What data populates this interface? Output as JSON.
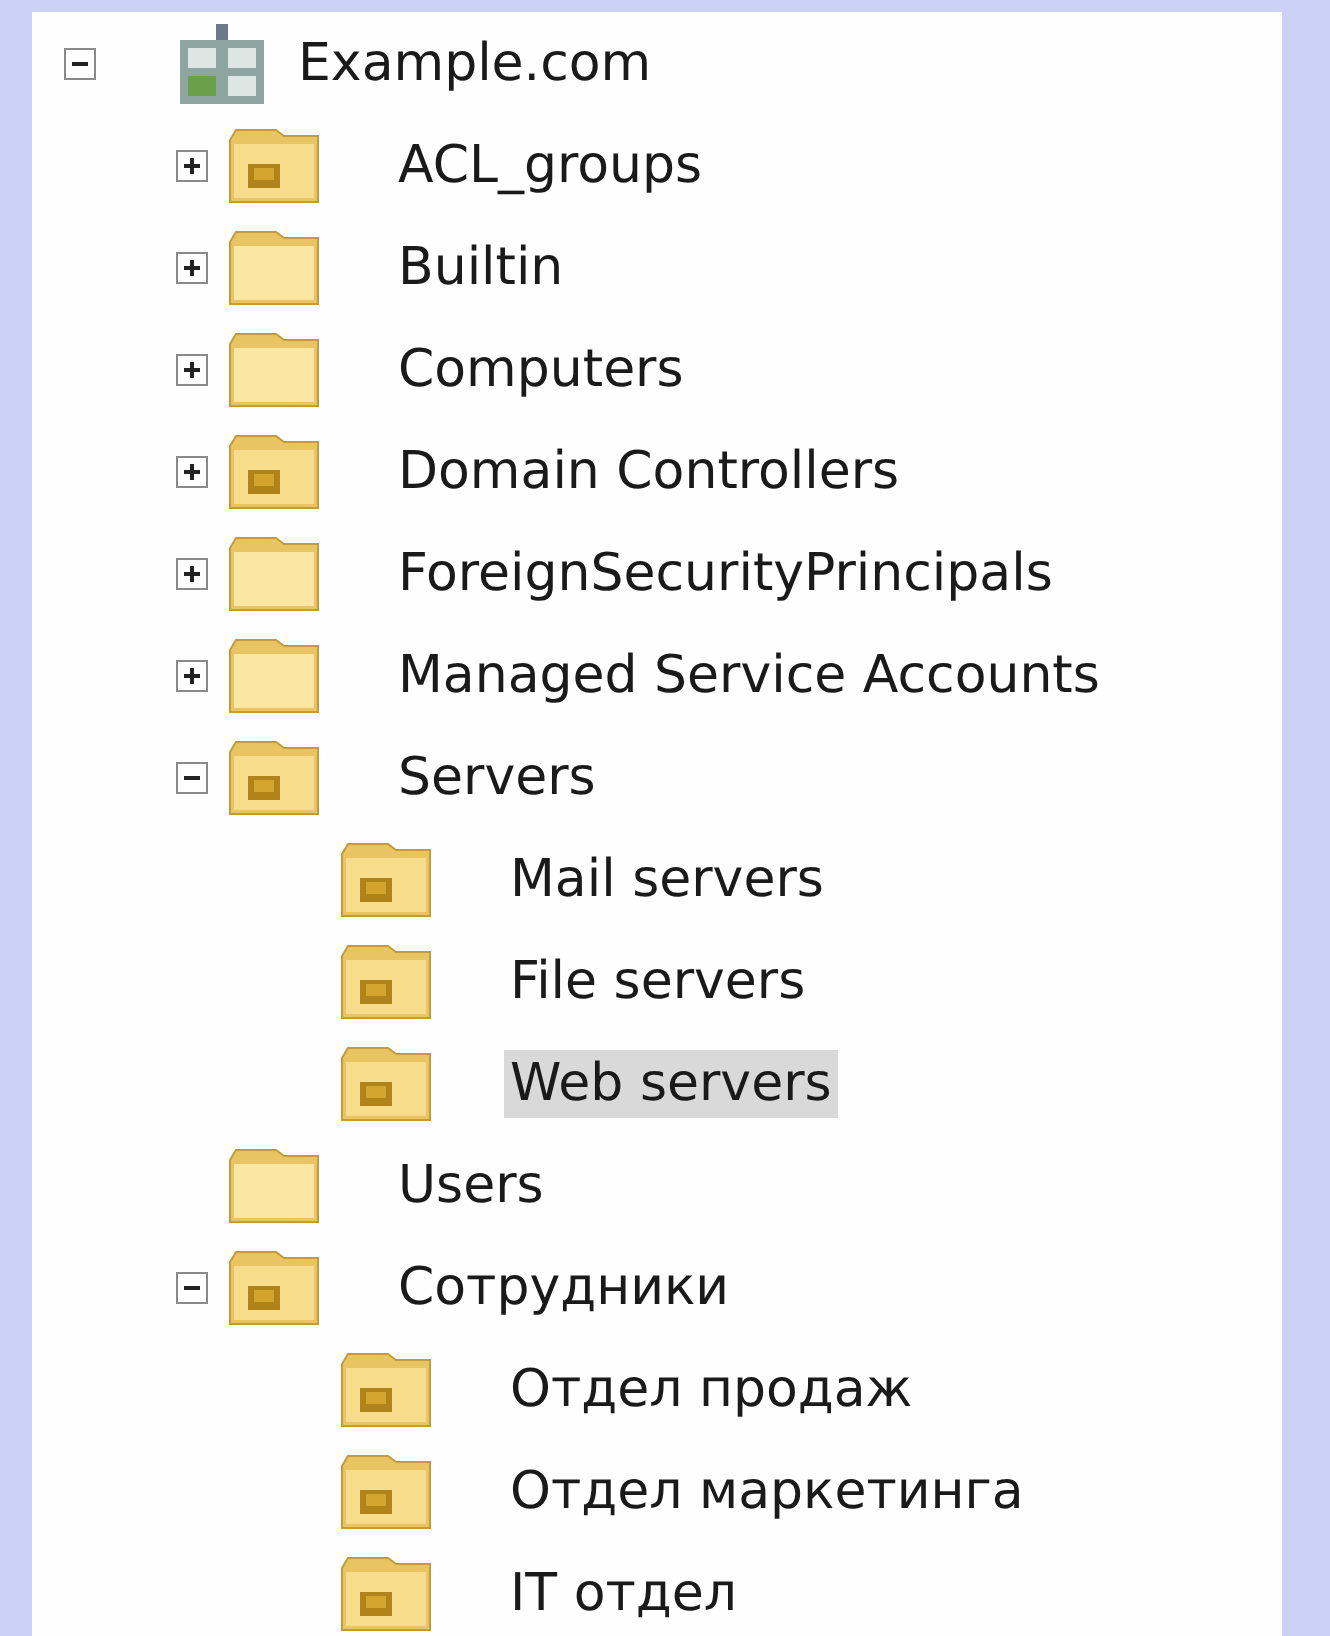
{
  "tree": [
    {
      "label": "Example.com",
      "kind": "domain",
      "expanded": true,
      "selected": false,
      "children": [
        {
          "label": "ACL_groups",
          "kind": "ou",
          "expanded": false,
          "selected": false
        },
        {
          "label": "Builtin",
          "kind": "container",
          "expanded": false,
          "selected": false
        },
        {
          "label": "Computers",
          "kind": "container",
          "expanded": false,
          "selected": false
        },
        {
          "label": "Domain Controllers",
          "kind": "ou",
          "expanded": false,
          "selected": false
        },
        {
          "label": "ForeignSecurityPrincipals",
          "kind": "container",
          "expanded": false,
          "selected": false
        },
        {
          "label": "Managed Service Accounts",
          "kind": "container",
          "expanded": false,
          "selected": false
        },
        {
          "label": "Servers",
          "kind": "ou",
          "expanded": true,
          "selected": false,
          "children": [
            {
              "label": "Mail servers",
              "kind": "ou",
              "selected": false
            },
            {
              "label": "File servers",
              "kind": "ou",
              "selected": false
            },
            {
              "label": "Web servers",
              "kind": "ou",
              "selected": true
            }
          ]
        },
        {
          "label": "Users",
          "kind": "container",
          "selected": false
        },
        {
          "label": "Сотрудники",
          "kind": "ou",
          "expanded": true,
          "selected": false,
          "children": [
            {
              "label": "Отдел продаж",
              "kind": "ou",
              "selected": false
            },
            {
              "label": "Отдел маркетинга",
              "kind": "ou",
              "selected": false
            },
            {
              "label": "IT отдел",
              "kind": "ou",
              "selected": false
            }
          ]
        }
      ]
    }
  ]
}
